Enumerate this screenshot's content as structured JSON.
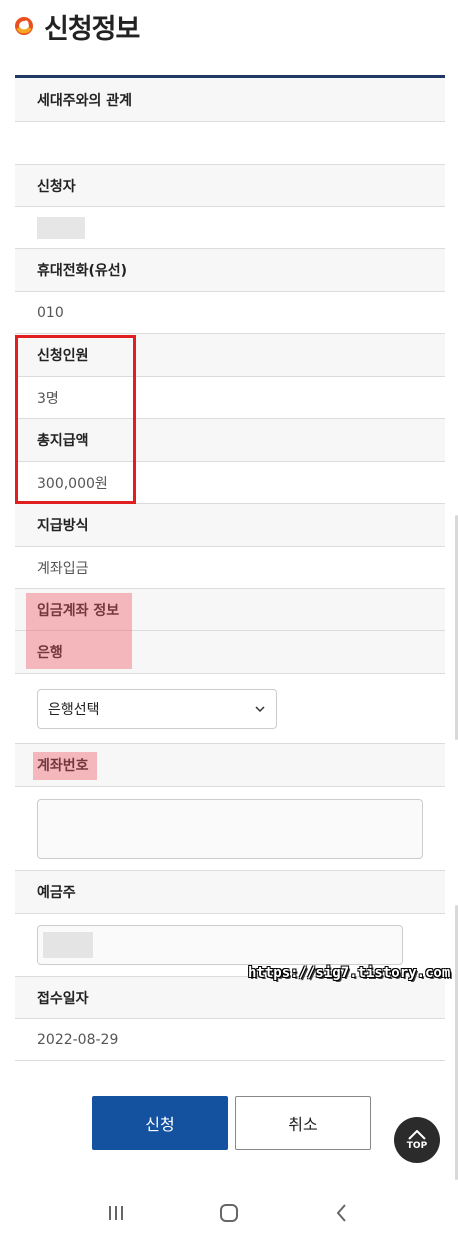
{
  "header": {
    "title": "신청정보",
    "logo_icon": "orange-swirl-logo"
  },
  "fields": {
    "relation_label": "세대주와의 관계",
    "relation_value": "",
    "applicant_label": "신청자",
    "phone_label": "휴대전화(유선)",
    "phone_value": "010",
    "headcount_label": "신청인원",
    "headcount_value": "3명",
    "total_label": "총지급액",
    "total_value": "300,000원",
    "method_label": "지급방식",
    "method_value": "계좌입금",
    "deposit_info_label": "입금계좌 정보",
    "bank_label": "은행",
    "bank_select_value": "은행선택",
    "account_label": "계좌번호",
    "account_value": "",
    "holder_label": "예금주",
    "date_label": "접수일자",
    "date_value": "2022-08-29"
  },
  "buttons": {
    "apply": "신청",
    "cancel": "취소",
    "top": "TOP"
  },
  "watermark": "https://sig7.tistory.com",
  "colors": {
    "accent_navy": "#1f3864",
    "button_blue": "#1452a0",
    "highlight_red": "#e02020",
    "highlight_pink": "#f5a0a6"
  }
}
